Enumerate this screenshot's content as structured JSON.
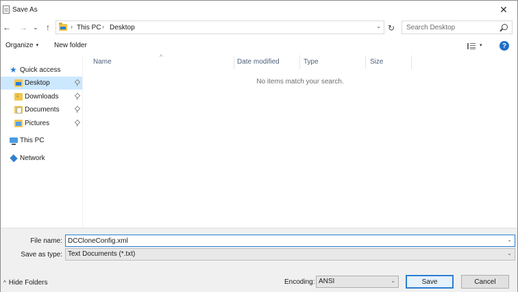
{
  "window": {
    "title": "Save As",
    "close_glyph": "✕"
  },
  "nav": {
    "back_glyph": "←",
    "forward_glyph": "→",
    "recent_glyph": "⌄",
    "up_glyph": "↑",
    "refresh_glyph": "↻",
    "breadcrumb": [
      "This PC",
      "Desktop"
    ],
    "breadcrumb_sep": "›",
    "address_dropdown_glyph": "⌄",
    "search_placeholder": "Search Desktop"
  },
  "toolbar": {
    "organize_label": "Organize",
    "new_folder_label": "New folder",
    "caret_glyph": "▾",
    "help_glyph": "?"
  },
  "sidebar": {
    "items": [
      {
        "label": "Quick access",
        "icon": "star-icon",
        "pinned": false,
        "selected": false
      },
      {
        "label": "Desktop",
        "icon": "desktop-folder-icon",
        "pinned": true,
        "selected": true
      },
      {
        "label": "Downloads",
        "icon": "downloads-folder-icon",
        "pinned": true,
        "selected": false
      },
      {
        "label": "Documents",
        "icon": "documents-folder-icon",
        "pinned": true,
        "selected": false
      },
      {
        "label": "Pictures",
        "icon": "pictures-folder-icon",
        "pinned": true,
        "selected": false
      },
      {
        "label": "This PC",
        "icon": "computer-icon",
        "pinned": false,
        "selected": false
      },
      {
        "label": "Network",
        "icon": "network-icon",
        "pinned": false,
        "selected": false
      }
    ]
  },
  "content": {
    "columns": [
      "Name",
      "Date modified",
      "Type",
      "Size"
    ],
    "sort_glyph": "^",
    "empty_message": "No items match your search."
  },
  "form": {
    "filename_label": "File name:",
    "filename_value": "DCCloneConfig.xml",
    "savetype_label": "Save as type:",
    "savetype_value": "Text Documents (*.txt)",
    "dropdown_glyph": "⌄",
    "hide_folders_label": "Hide Folders",
    "hide_folders_glyph": "^",
    "encoding_label": "Encoding:",
    "encoding_value": "ANSI",
    "save_label": "Save",
    "cancel_label": "Cancel"
  },
  "colors": {
    "accent": "#2b7cd3",
    "selection": "#cce8ff",
    "help": "#1e6fc9"
  }
}
